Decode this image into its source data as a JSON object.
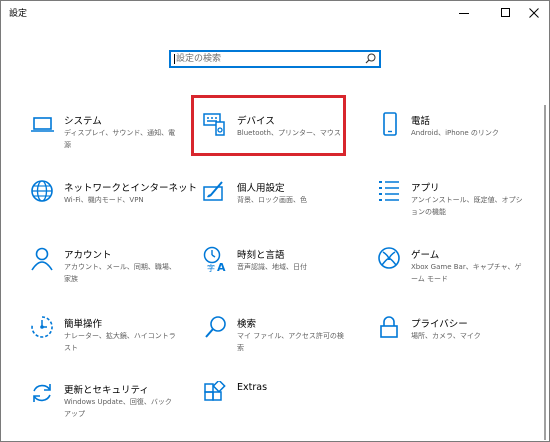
{
  "window": {
    "title": "設定"
  },
  "search": {
    "placeholder": "設定の検索"
  },
  "tiles": [
    {
      "title": "システム",
      "desc": "ディスプレイ、サウンド、通知、電源",
      "icon": "laptop-icon"
    },
    {
      "title": "デバイス",
      "desc": "Bluetooth、プリンター、マウス",
      "icon": "devices-icon"
    },
    {
      "title": "電話",
      "desc": "Android、iPhone のリンク",
      "icon": "phone-icon"
    },
    {
      "title": "ネットワークとインターネット",
      "desc": "Wi-Fi、機内モード、VPN",
      "icon": "globe-icon"
    },
    {
      "title": "個人用設定",
      "desc": "背景、ロック画面、色",
      "icon": "personalization-icon"
    },
    {
      "title": "アプリ",
      "desc": "アンインストール、既定値、オプションの機能",
      "icon": "apps-list-icon"
    },
    {
      "title": "アカウント",
      "desc": "アカウント、メール、同期、職場、家族",
      "icon": "person-icon"
    },
    {
      "title": "時刻と言語",
      "desc": "音声認識、地域、日付",
      "icon": "time-language-icon"
    },
    {
      "title": "ゲーム",
      "desc": "Xbox Game Bar、キャプチャ、ゲーム モード",
      "icon": "xbox-icon"
    },
    {
      "title": "簡単操作",
      "desc": "ナレーター、拡大鏡、ハイコントラスト",
      "icon": "ease-of-access-icon"
    },
    {
      "title": "検索",
      "desc": "マイ ファイル、アクセス許可の検索",
      "icon": "magnifier-icon"
    },
    {
      "title": "プライバシー",
      "desc": "場所、カメラ、マイク",
      "icon": "lock-icon"
    },
    {
      "title": "更新とセキュリティ",
      "desc": "Windows Update、回復、バックアップ",
      "icon": "sync-icon"
    },
    {
      "title": "Extras",
      "desc": "",
      "icon": "extras-icon"
    }
  ],
  "colors": {
    "accent": "#0078d7",
    "highlight": "#d8262d"
  }
}
